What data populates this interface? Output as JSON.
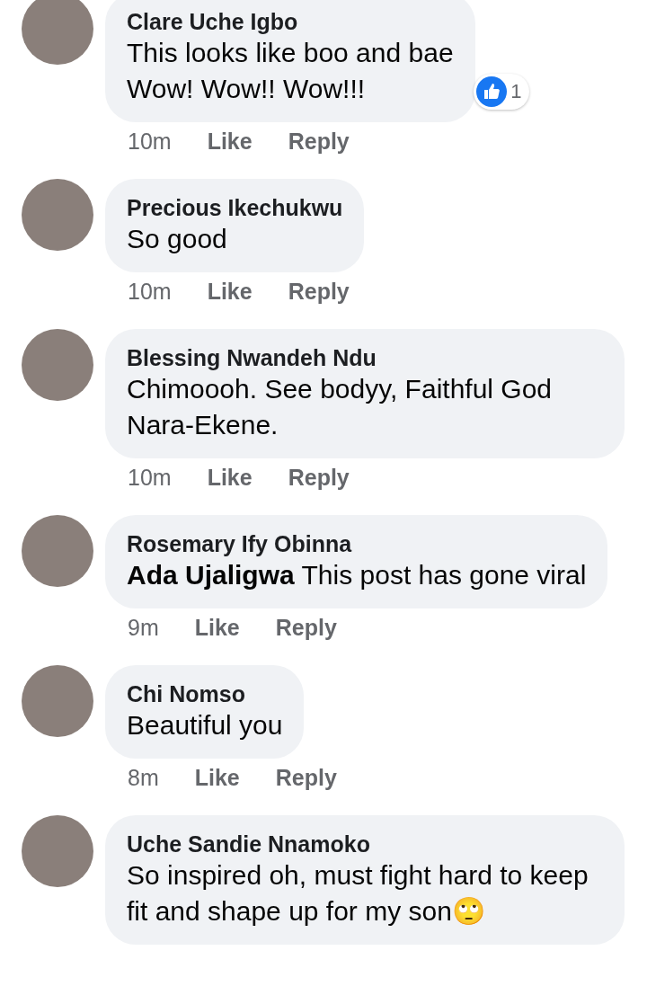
{
  "comments": [
    {
      "author": "Clare Uche Igbo",
      "text": "This looks like boo and bae\nWow! Wow!! Wow!!!",
      "time": "10m",
      "like": "Like",
      "reply": "Reply",
      "reaction": {
        "count": "1"
      }
    },
    {
      "author": "Precious Ikechukwu",
      "text": "So good",
      "time": "10m",
      "like": "Like",
      "reply": "Reply"
    },
    {
      "author": "Blessing Nwandeh Ndu",
      "text": "Chimoooh. See bodyy, Faithful God Nara-Ekene.",
      "time": "10m",
      "like": "Like",
      "reply": "Reply"
    },
    {
      "author": "Rosemary Ify Obinna",
      "text": "**Ada Ujaligwa** This post has gone viral",
      "time": "9m",
      "like": "Like",
      "reply": "Reply"
    },
    {
      "author": "Chi Nomso",
      "text": "Beautiful you",
      "time": "8m",
      "like": "Like",
      "reply": "Reply"
    },
    {
      "author": "Uche Sandie Nnamoko",
      "text": "So inspired oh, must fight hard to keep fit and shape up for my son🙄"
    }
  ]
}
